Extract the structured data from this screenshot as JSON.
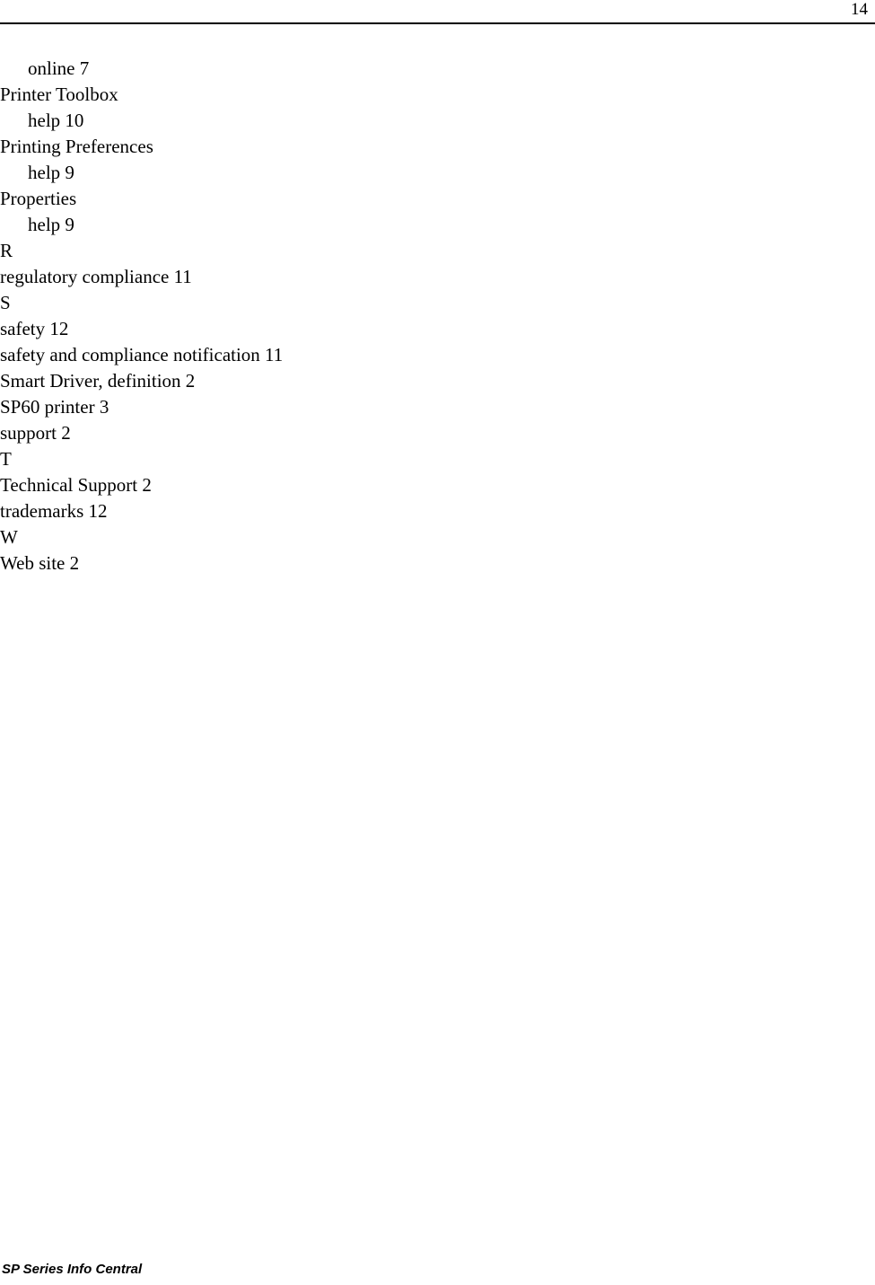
{
  "header": {
    "page_number": "14"
  },
  "index": {
    "entries": [
      {
        "text": "online 7",
        "level": 2
      },
      {
        "text": "Printer Toolbox",
        "level": 1
      },
      {
        "text": "help 10",
        "level": 2
      },
      {
        "text": "Printing Preferences",
        "level": 1
      },
      {
        "text": "help 9",
        "level": 2
      },
      {
        "text": "Properties",
        "level": 1
      },
      {
        "text": "help 9",
        "level": 2
      },
      {
        "text": "R",
        "level": 1
      },
      {
        "text": "regulatory compliance 11",
        "level": 1
      },
      {
        "text": "S",
        "level": 1
      },
      {
        "text": "safety 12",
        "level": 1
      },
      {
        "text": "safety and compliance notification 11",
        "level": 1
      },
      {
        "text": "Smart Driver, definition 2",
        "level": 1
      },
      {
        "text": "SP60 printer 3",
        "level": 1
      },
      {
        "text": "support 2",
        "level": 1
      },
      {
        "text": "T",
        "level": 1
      },
      {
        "text": "Technical Support 2",
        "level": 1
      },
      {
        "text": "trademarks 12",
        "level": 1
      },
      {
        "text": "W",
        "level": 1
      },
      {
        "text": "Web site 2",
        "level": 1
      }
    ]
  },
  "footer": {
    "text": "SP Series Info Central"
  }
}
